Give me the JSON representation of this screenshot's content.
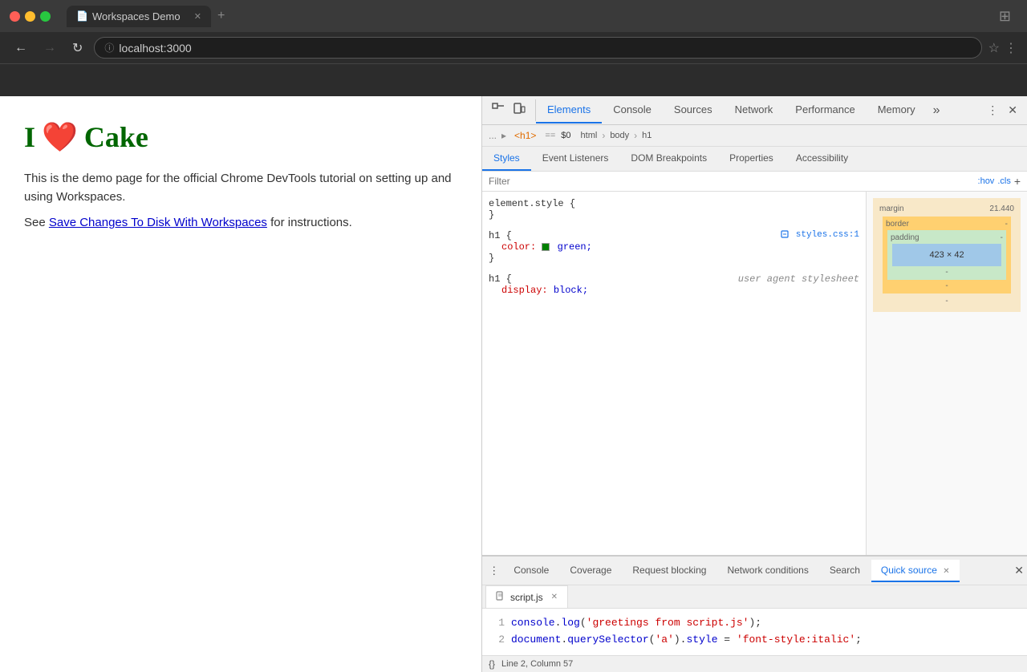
{
  "browser": {
    "title": "Workspaces Demo",
    "address": "localhost:3000",
    "traffic_lights": [
      "red",
      "yellow",
      "green"
    ],
    "nav_back_disabled": false,
    "nav_forward_disabled": true
  },
  "page": {
    "heading_prefix": "I",
    "heading_main": "Cake",
    "heart": "❤️",
    "body_text": "This is the demo page for the official Chrome DevTools tutorial on setting up and using Workspaces.",
    "link_prefix": "See ",
    "link_text": "Save Changes To Disk With Workspaces",
    "link_suffix": " for instructions."
  },
  "devtools": {
    "tabs": [
      {
        "label": "Elements",
        "active": true
      },
      {
        "label": "Console",
        "active": false
      },
      {
        "label": "Sources",
        "active": false
      },
      {
        "label": "Network",
        "active": false
      },
      {
        "label": "Performance",
        "active": false
      },
      {
        "label": "Memory",
        "active": false
      }
    ],
    "breadcrumb": [
      "html",
      "body",
      "h1"
    ],
    "breadcrumb_prefix": "...",
    "breadcrumb_h1_text": "<h1>",
    "breadcrumb_arrow": "==",
    "breadcrumb_eq": "$0",
    "styles_tabs": [
      "Styles",
      "Event Listeners",
      "DOM Breakpoints",
      "Properties",
      "Accessibility"
    ],
    "filter_placeholder": "Filter",
    "filter_hov": ":hov",
    "filter_cls": ".cls",
    "css_rules": [
      {
        "selector": "element.style {",
        "close": "}",
        "properties": []
      },
      {
        "selector": "h1 {",
        "source": "styles.css:1",
        "close": "}",
        "properties": [
          {
            "prop": "color:",
            "value": "green;",
            "has_swatch": true
          }
        ]
      },
      {
        "selector": "h1 {",
        "comment": "user agent stylesheet",
        "close": "",
        "properties": [
          {
            "prop": "display:",
            "value": "block;"
          }
        ]
      }
    ],
    "box_model": {
      "margin_label": "margin",
      "margin_value": "21.440",
      "border_label": "border",
      "border_value": "-",
      "padding_label": "padding",
      "padding_value": "-",
      "content_value": "423 × 42",
      "bottom_dash": "-"
    }
  },
  "drawer": {
    "tabs": [
      {
        "label": "Console",
        "active": false,
        "closeable": false
      },
      {
        "label": "Coverage",
        "active": false,
        "closeable": false
      },
      {
        "label": "Request blocking",
        "active": false,
        "closeable": false
      },
      {
        "label": "Network conditions",
        "active": false,
        "closeable": false
      },
      {
        "label": "Search",
        "active": false,
        "closeable": false
      },
      {
        "label": "Quick source",
        "active": true,
        "closeable": true
      }
    ],
    "source_file": "script.js",
    "source_lines": [
      {
        "num": "1",
        "code": "console.log('greetings from script.js');"
      },
      {
        "num": "2",
        "code": "document.querySelector('a').style = 'font-style:italic';"
      }
    ]
  },
  "status_bar": {
    "icon": "{}",
    "text": "Line 2, Column 57"
  }
}
